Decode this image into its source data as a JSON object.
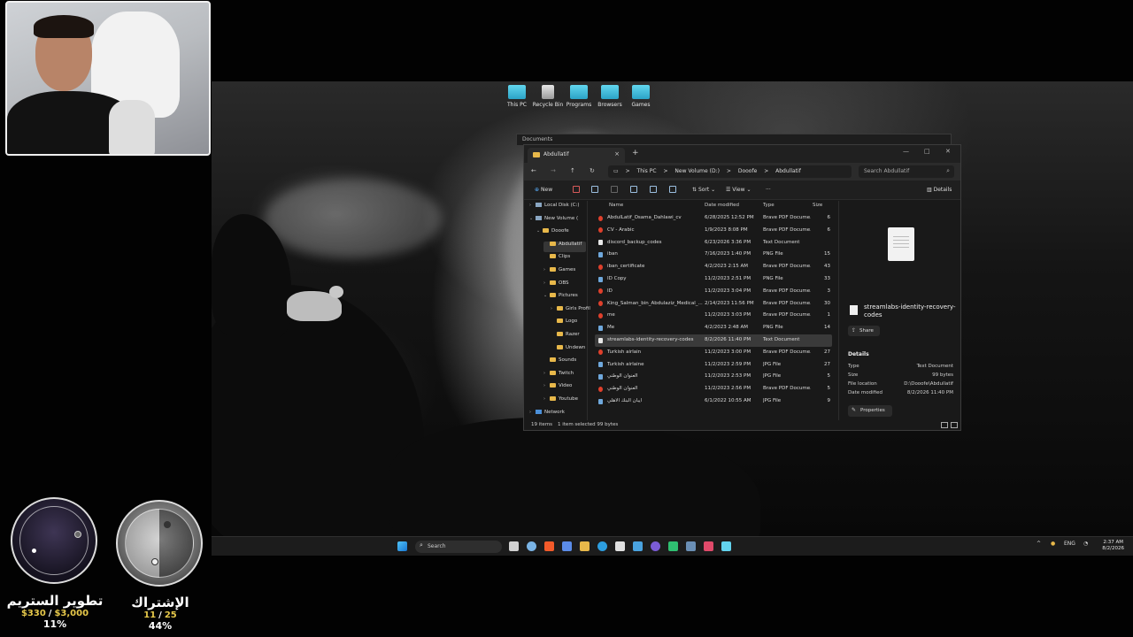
{
  "desktop_icons": [
    {
      "label": "This PC",
      "icon": "monitor-icon"
    },
    {
      "label": "Recycle Bin",
      "icon": "recycle-bin-icon"
    },
    {
      "label": "Programs",
      "icon": "folder-icon"
    },
    {
      "label": "Browsers",
      "icon": "folder-icon"
    },
    {
      "label": "Games",
      "icon": "folder-icon"
    }
  ],
  "back_window": {
    "title": "Documents"
  },
  "explorer": {
    "tab_title": "Abdullatif",
    "breadcrumb": [
      "This PC",
      ">",
      "New Volume (D:)",
      ">",
      "Dooofe",
      ">",
      "Abdullatif"
    ],
    "search_placeholder": "Search Abdullatif",
    "toolbar": {
      "new": "New",
      "sort": "Sort",
      "view": "View",
      "more": "···",
      "details": "Details"
    },
    "nav": [
      {
        "label": "Local Disk (C:)",
        "type": "drive",
        "chev": "›"
      },
      {
        "label": "New Volume (",
        "type": "drive",
        "chev": "⌄"
      },
      {
        "label": "Dooofe",
        "type": "folder",
        "chev": "⌄"
      },
      {
        "label": "Abdullatif",
        "type": "folder",
        "chev": "",
        "selected": true
      },
      {
        "label": "Clips",
        "type": "folder",
        "chev": ""
      },
      {
        "label": "Games",
        "type": "folder",
        "chev": "›"
      },
      {
        "label": "OBS",
        "type": "folder",
        "chev": "›"
      },
      {
        "label": "Pictures",
        "type": "folder",
        "chev": "⌄"
      },
      {
        "label": "Girls Profil",
        "type": "folder",
        "chev": "›"
      },
      {
        "label": "Logo",
        "type": "folder",
        "chev": ""
      },
      {
        "label": "Razer",
        "type": "folder",
        "chev": ""
      },
      {
        "label": "Undewn",
        "type": "folder",
        "chev": ""
      },
      {
        "label": "Sounds",
        "type": "folder",
        "chev": ""
      },
      {
        "label": "Twitch",
        "type": "folder",
        "chev": "›"
      },
      {
        "label": "Video",
        "type": "folder",
        "chev": "›"
      },
      {
        "label": "Youtube",
        "type": "folder",
        "chev": "›"
      },
      {
        "label": "Network",
        "type": "network",
        "chev": "›"
      }
    ],
    "columns": {
      "name": "Name",
      "date": "Date modified",
      "type": "Type",
      "size": "Size"
    },
    "files": [
      {
        "name": "AbdulLatif_Osama_Dahlawi_cv",
        "date": "6/28/2025 12:52 PM",
        "type": "Brave PDF Docume...",
        "size": "6",
        "kind": "pdf"
      },
      {
        "name": "CV - Arabic",
        "date": "1/9/2023 8:08 PM",
        "type": "Brave PDF Docume...",
        "size": "6",
        "kind": "pdf"
      },
      {
        "name": "discord_backup_codes",
        "date": "6/23/2026 3:36 PM",
        "type": "Text Document",
        "size": "",
        "kind": "txt"
      },
      {
        "name": "iban",
        "date": "7/16/2023 1:40 PM",
        "type": "PNG File",
        "size": "15",
        "kind": "img"
      },
      {
        "name": "iban_certificate",
        "date": "4/2/2023 2:15 AM",
        "type": "Brave PDF Docume...",
        "size": "43",
        "kind": "pdf"
      },
      {
        "name": "ID Copy",
        "date": "11/2/2023 2:51 PM",
        "type": "PNG File",
        "size": "33",
        "kind": "img"
      },
      {
        "name": "ID",
        "date": "11/2/2023 3:04 PM",
        "type": "Brave PDF Docume...",
        "size": "3",
        "kind": "pdf"
      },
      {
        "name": "King_Salman_bin_Abdulaziz_Medical_...",
        "date": "2/14/2023 11:56 PM",
        "type": "Brave PDF Docume...",
        "size": "30",
        "kind": "pdf"
      },
      {
        "name": "me",
        "date": "11/2/2023 3:03 PM",
        "type": "Brave PDF Docume...",
        "size": "1",
        "kind": "pdf"
      },
      {
        "name": "Me",
        "date": "4/2/2023 2:48 AM",
        "type": "PNG File",
        "size": "14",
        "kind": "img"
      },
      {
        "name": "streamlabs-identity-recovery-codes",
        "date": "8/2/2026 11:40 PM",
        "type": "Text Document",
        "size": "",
        "kind": "txt",
        "selected": true
      },
      {
        "name": "Turkish airlain",
        "date": "11/2/2023 3:00 PM",
        "type": "Brave PDF Docume...",
        "size": "27",
        "kind": "pdf"
      },
      {
        "name": "Turkish airlaine",
        "date": "11/2/2023 2:59 PM",
        "type": "JPG File",
        "size": "27",
        "kind": "img"
      },
      {
        "name": "العنوان الوطني",
        "date": "11/2/2023 2:53 PM",
        "type": "JPG File",
        "size": "5",
        "kind": "img"
      },
      {
        "name": "العنوان الوطني",
        "date": "11/2/2023 2:56 PM",
        "type": "Brave PDF Docume...",
        "size": "5",
        "kind": "pdf"
      },
      {
        "name": "ايبان البنك الاهلي",
        "date": "6/1/2022 10:55 AM",
        "type": "JPG File",
        "size": "9",
        "kind": "img"
      }
    ],
    "details": {
      "file_title": "streamlabs-identity-recovery-codes",
      "share": "Share",
      "section": "Details",
      "rows": [
        {
          "k": "Type",
          "v": "Text Document"
        },
        {
          "k": "Size",
          "v": "99 bytes"
        },
        {
          "k": "File location",
          "v": "D:\\Dooofe\\Abdullatif"
        },
        {
          "k": "Date modified",
          "v": "8/2/2026 11:40 PM"
        }
      ],
      "properties": "Properties"
    },
    "status": {
      "items": "19 items",
      "selected": "1 item selected  99 bytes"
    }
  },
  "taskbar": {
    "search": "Search",
    "lang": "ENG",
    "time": "2:37 AM",
    "date": "8/2/2026",
    "tray_up": "^"
  },
  "goals": [
    {
      "title": "تطوير الستريم",
      "current": "$330",
      "sep": "/",
      "target": "$3,000",
      "percent": "11%",
      "progress": 0.11
    },
    {
      "title": "الإشتراك",
      "current": "11",
      "sep": "/",
      "target": "25",
      "percent": "44%",
      "progress": 0.44
    }
  ],
  "colors": {
    "accent": "#4a90e2",
    "goal_gold": "#e6c84a",
    "folder": "#e8b84a"
  }
}
